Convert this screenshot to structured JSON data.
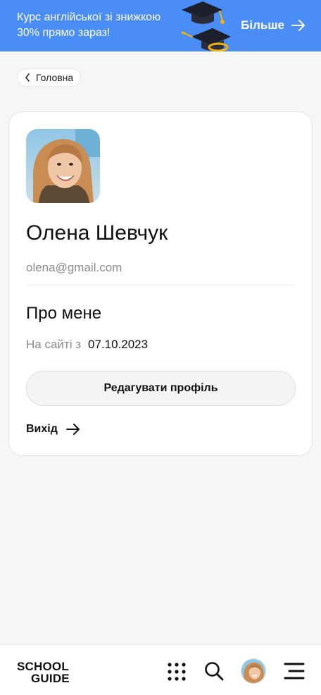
{
  "banner": {
    "text": "Курс англійської зі знижкою 30% прямо зараз!",
    "more_label": "Більше",
    "bg_color": "#4a8df6"
  },
  "breadcrumb": {
    "label": "Головна"
  },
  "profile": {
    "name": "Олена Шевчук",
    "email": "olena@gmail.com",
    "about_title": "Про мене",
    "since_label": "На сайті з",
    "since_date": "07.10.2023",
    "edit_label": "Редагувати профіль",
    "logout_label": "Вихід"
  },
  "footer": {
    "logo_line1": "SCHOOL",
    "logo_line2": "GUIDE",
    "icons": [
      "apps-grid-icon",
      "search-icon",
      "user-avatar",
      "menu-icon"
    ]
  }
}
